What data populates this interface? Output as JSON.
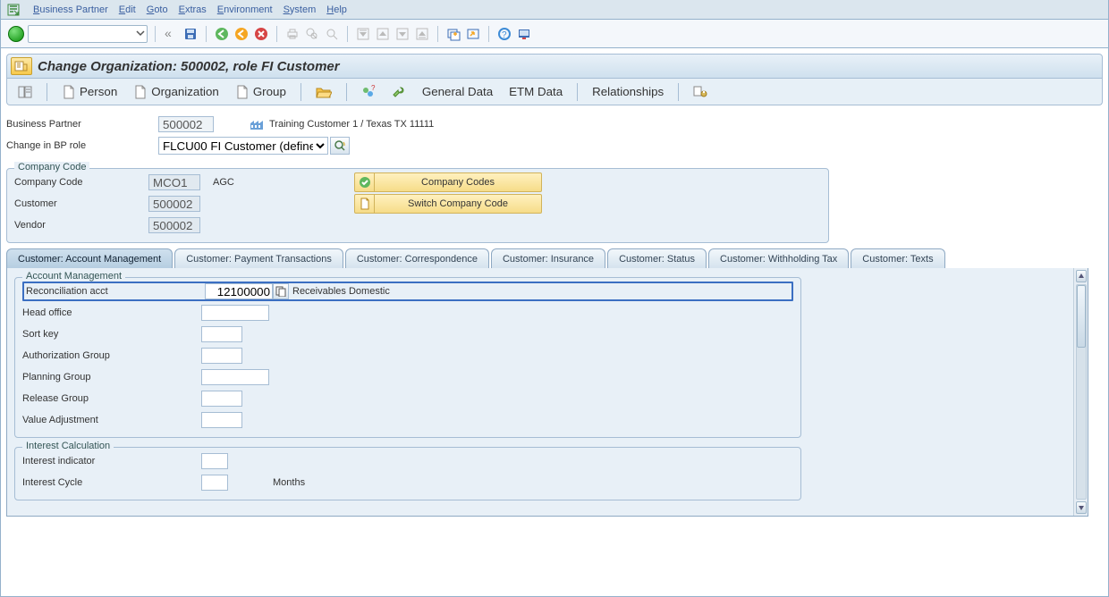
{
  "menu": {
    "items": [
      "Business Partner",
      "Edit",
      "Goto",
      "Extras",
      "Environment",
      "System",
      "Help"
    ]
  },
  "title": "Change Organization: 500002, role FI Customer",
  "apptoolbar": {
    "person": "Person",
    "org": "Organization",
    "group": "Group",
    "general": "General Data",
    "etm": "ETM Data",
    "rel": "Relationships"
  },
  "header": {
    "bp_label": "Business Partner",
    "bp_value": "500002",
    "desc": "Training Customer 1 / Texas TX 11111",
    "role_label": "Change in BP role",
    "role_value": "FLCU00 FI Customer (define…"
  },
  "cc": {
    "group": "Company Code",
    "cc_label": "Company Code",
    "cc_value": "MCO1",
    "cc_text": "AGC",
    "cust_label": "Customer",
    "cust_value": "500002",
    "vendor_label": "Vendor",
    "vendor_value": "500002",
    "btn1": "Company Codes",
    "btn2": "Switch Company Code"
  },
  "tabs": [
    "Customer: Account Management",
    "Customer: Payment Transactions",
    "Customer: Correspondence",
    "Customer: Insurance",
    "Customer: Status",
    "Customer: Withholding Tax",
    "Customer: Texts"
  ],
  "am": {
    "group": "Account Management",
    "ra_label": "Reconciliation acct",
    "ra_value": "12100000",
    "ra_text": "Receivables Domestic",
    "ho_label": "Head office",
    "sk_label": "Sort key",
    "ag_label": "Authorization Group",
    "pg_label": "Planning Group",
    "rg_label": "Release Group",
    "va_label": "Value Adjustment"
  },
  "ic": {
    "group": "Interest Calculation",
    "ii_label": "Interest indicator",
    "cy_label": "Interest Cycle",
    "cy_unit": "Months"
  }
}
